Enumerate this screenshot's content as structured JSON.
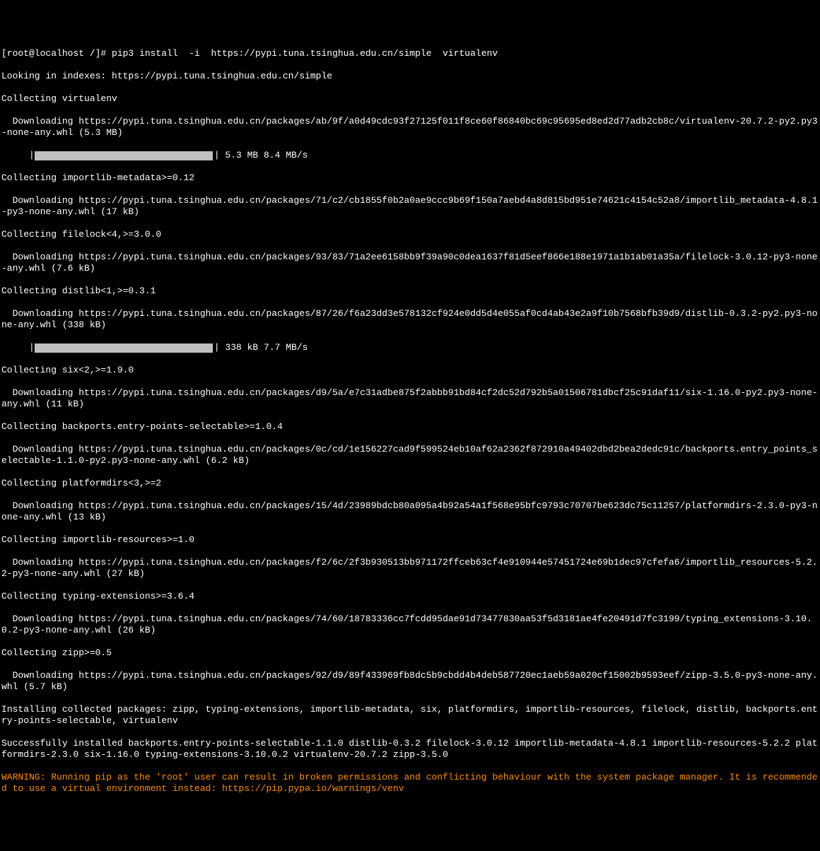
{
  "prompt": "[root@localhost /]# pip3 install  -i  https://pypi.tuna.tsinghua.edu.cn/simple  virtualenv",
  "l1": "Looking in indexes: https://pypi.tuna.tsinghua.edu.cn/simple",
  "l2": "Collecting virtualenv",
  "l3": "  Downloading https://pypi.tuna.tsinghua.edu.cn/packages/ab/9f/a0d49cdc93f27125f011f8ce60f86840bc69c95695ed8ed2d77adb2cb8c/virtualenv-20.7.2-py2.py3-none-any.whl (5.3 MB)",
  "p1_indent": "     |",
  "p1_tail": "| 5.3 MB 8.4 MB/s",
  "l5": "Collecting importlib-metadata>=0.12",
  "l6": "  Downloading https://pypi.tuna.tsinghua.edu.cn/packages/71/c2/cb1855f0b2a0ae9ccc9b69f150a7aebd4a8d815bd951e74621c4154c52a8/importlib_metadata-4.8.1-py3-none-any.whl (17 kB)",
  "l7": "Collecting filelock<4,>=3.0.0",
  "l8": "  Downloading https://pypi.tuna.tsinghua.edu.cn/packages/93/83/71a2ee6158bb9f39a90c0dea1637f81d5eef866e188e1971a1b1ab01a35a/filelock-3.0.12-py3-none-any.whl (7.6 kB)",
  "l9": "Collecting distlib<1,>=0.3.1",
  "l10": "  Downloading https://pypi.tuna.tsinghua.edu.cn/packages/87/26/f6a23dd3e578132cf924e0dd5d4e055af0cd4ab43e2a9f10b7568bfb39d9/distlib-0.3.2-py2.py3-none-any.whl (338 kB)",
  "p2_indent": "     |",
  "p2_tail": "| 338 kB 7.7 MB/s",
  "l12": "Collecting six<2,>=1.9.0",
  "l13": "  Downloading https://pypi.tuna.tsinghua.edu.cn/packages/d9/5a/e7c31adbe875f2abbb91bd84cf2dc52d792b5a01506781dbcf25c91daf11/six-1.16.0-py2.py3-none-any.whl (11 kB)",
  "l14": "Collecting backports.entry-points-selectable>=1.0.4",
  "l15": "  Downloading https://pypi.tuna.tsinghua.edu.cn/packages/0c/cd/1e156227cad9f599524eb10af62a2362f872910a49402dbd2bea2dedc91c/backports.entry_points_selectable-1.1.0-py2.py3-none-any.whl (6.2 kB)",
  "l16": "Collecting platformdirs<3,>=2",
  "l17": "  Downloading https://pypi.tuna.tsinghua.edu.cn/packages/15/4d/23989bdcb80a095a4b92a54a1f568e95bfc9793c70707be623dc75c11257/platformdirs-2.3.0-py3-none-any.whl (13 kB)",
  "l18": "Collecting importlib-resources>=1.0",
  "l19": "  Downloading https://pypi.tuna.tsinghua.edu.cn/packages/f2/6c/2f3b930513bb971172ffceb63cf4e910944e57451724e69b1dec97cfefa6/importlib_resources-5.2.2-py3-none-any.whl (27 kB)",
  "l20": "Collecting typing-extensions>=3.6.4",
  "l21": "  Downloading https://pypi.tuna.tsinghua.edu.cn/packages/74/60/18783336cc7fcdd95dae91d73477830aa53f5d3181ae4fe20491d7fc3199/typing_extensions-3.10.0.2-py3-none-any.whl (26 kB)",
  "l22": "Collecting zipp>=0.5",
  "l23": "  Downloading https://pypi.tuna.tsinghua.edu.cn/packages/92/d9/89f433969fb8dc5b9cbdd4b4deb587720ec1aeb59a020cf15002b9593eef/zipp-3.5.0-py3-none-any.whl (5.7 kB)",
  "l24": "Installing collected packages: zipp, typing-extensions, importlib-metadata, six, platformdirs, importlib-resources, filelock, distlib, backports.entry-points-selectable, virtualenv",
  "l25": "Successfully installed backports.entry-points-selectable-1.1.0 distlib-0.3.2 filelock-3.0.12 importlib-metadata-4.8.1 importlib-resources-5.2.2 platformdirs-2.3.0 six-1.16.0 typing-extensions-3.10.0.2 virtualenv-20.7.2 zipp-3.5.0",
  "warn": "WARNING: Running pip as the 'root' user can result in broken permissions and conflicting behaviour with the system package manager. It is recommended to use a virtual environment instead: https://pip.pypa.io/warnings/venv"
}
